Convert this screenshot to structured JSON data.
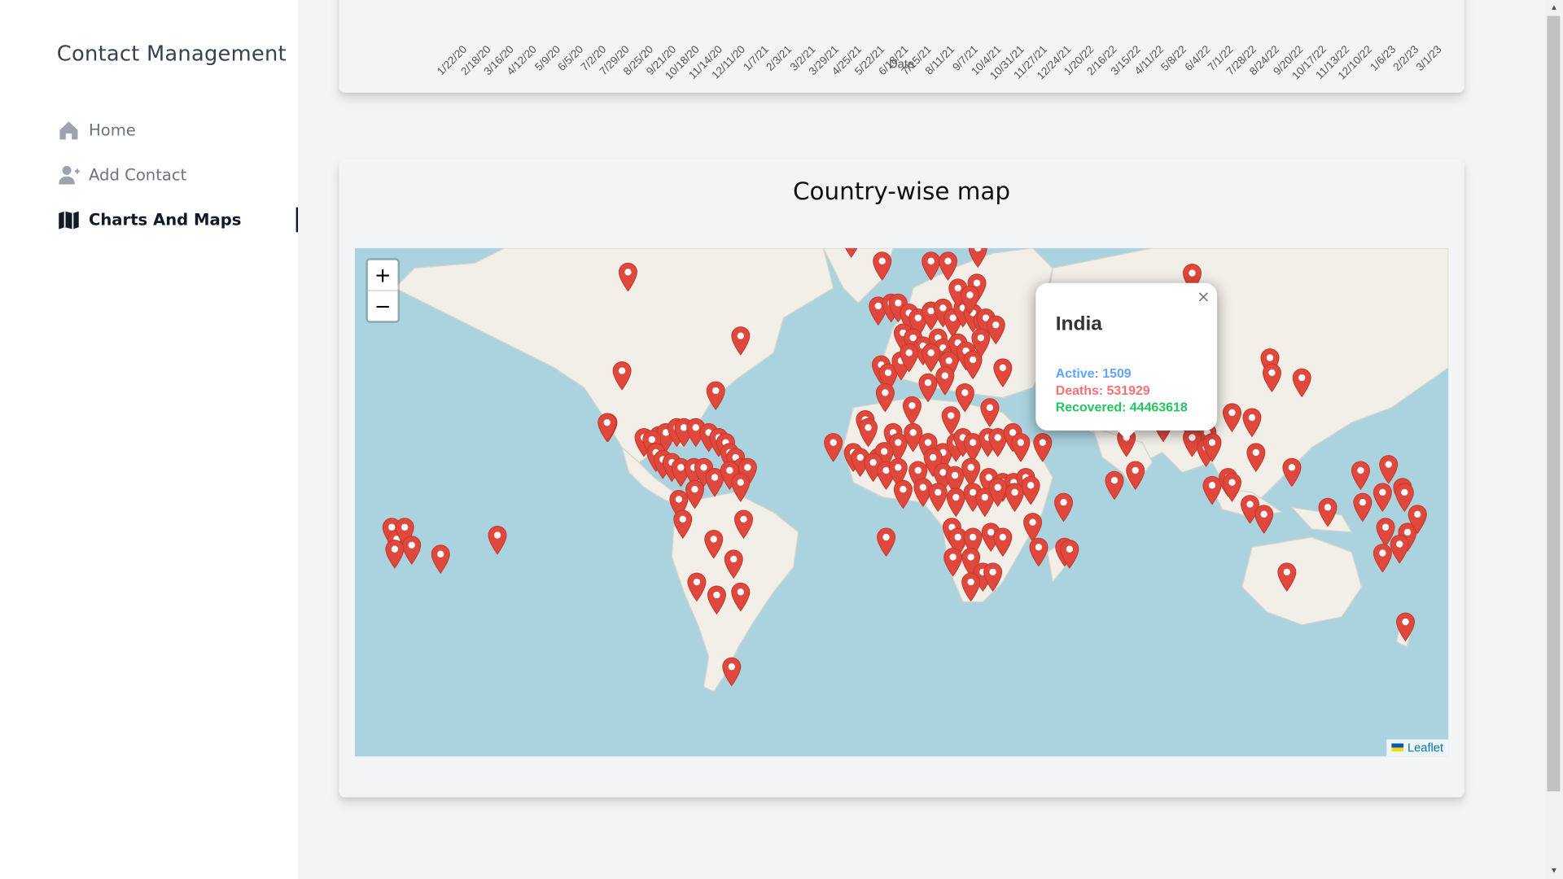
{
  "sidebar": {
    "brand": "Contact Management",
    "items": [
      {
        "label": "Home",
        "icon": "home-icon",
        "active": false
      },
      {
        "label": "Add Contact",
        "icon": "add-user-icon",
        "active": false
      },
      {
        "label": "Charts And Maps",
        "icon": "map-icon",
        "active": true
      }
    ]
  },
  "line_chart_axis": {
    "xlabel": "Date",
    "ticks": [
      "1/22/20",
      "2/18/20",
      "3/16/20",
      "4/12/20",
      "5/9/20",
      "6/5/20",
      "7/2/20",
      "7/29/20",
      "8/25/20",
      "9/21/20",
      "10/18/20",
      "11/14/20",
      "12/11/20",
      "1/7/21",
      "2/3/21",
      "3/2/21",
      "3/29/21",
      "4/25/21",
      "5/22/21",
      "6/18/21",
      "7/15/21",
      "8/11/21",
      "9/7/21",
      "10/4/21",
      "10/31/21",
      "11/27/21",
      "12/24/21",
      "1/20/22",
      "2/16/22",
      "3/15/22",
      "4/11/22",
      "5/8/22",
      "6/4/22",
      "7/1/22",
      "7/28/22",
      "8/24/22",
      "9/20/22",
      "10/17/22",
      "11/13/22",
      "12/10/22",
      "1/6/23",
      "2/2/23",
      "3/1/23"
    ]
  },
  "map_section": {
    "title": "Country-wise map",
    "zoom_in": "+",
    "zoom_out": "−",
    "attribution": "Leaflet",
    "marker_color": "#e0473d",
    "popup": {
      "country": "India",
      "active": "Active: 1509",
      "deaths": "Deaths: 531929",
      "recovered": "Recovered: 44463618",
      "close": "×"
    }
  },
  "colors": {
    "active": "#60a5fa",
    "deaths": "#f87171",
    "recovered": "#22c55e"
  }
}
